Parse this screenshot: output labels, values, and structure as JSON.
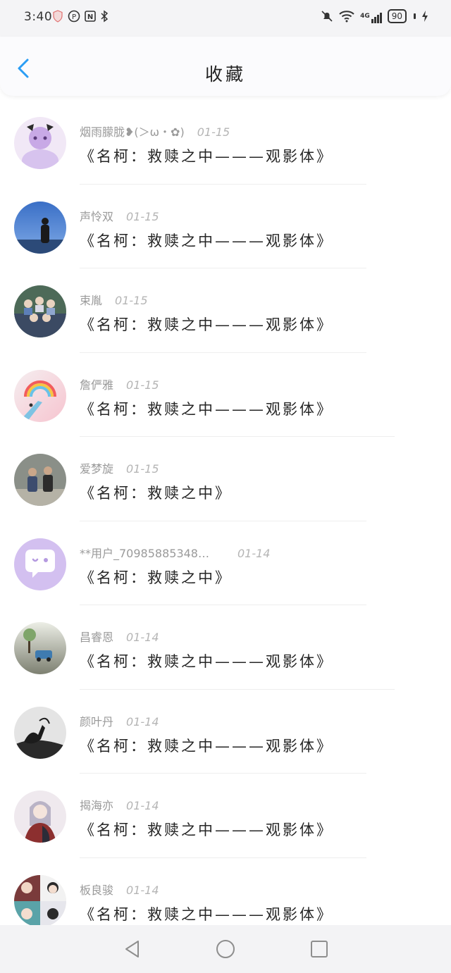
{
  "status_bar": {
    "time": "3:40",
    "left_icons": [
      "shield-icon",
      "nfc-p-icon",
      "nfc-n-icon",
      "bluetooth-icon"
    ],
    "right_icons": [
      "mute-bell-icon",
      "wifi-icon",
      "signal-4g-icon"
    ],
    "network": "4G",
    "battery": "90"
  },
  "header": {
    "title": "收藏",
    "back_icon": "chevron-left-icon"
  },
  "items": [
    {
      "user": "烟雨朦胧❥(＞ω・✿)",
      "date": "01-15",
      "text": "《名柯：救赎之中———观影体》"
    },
    {
      "user": "声怜双",
      "date": "01-15",
      "text": "《名柯：救赎之中———观影体》"
    },
    {
      "user": "束胤",
      "date": "01-15",
      "text": "《名柯：救赎之中———观影体》"
    },
    {
      "user": "詹俨雅",
      "date": "01-15",
      "text": "《名柯：救赎之中———观影体》"
    },
    {
      "user": "爱梦旋",
      "date": "01-15",
      "text": "《名柯：救赎之中》"
    },
    {
      "user": "**用户_709858853​48…",
      "date": "01-14",
      "text": "《名柯：救赎之中》"
    },
    {
      "user": "昌睿恩",
      "date": "01-14",
      "text": "《名柯：救赎之中———观影体》"
    },
    {
      "user": "颜叶丹",
      "date": "01-14",
      "text": "《名柯：救赎之中———观影体》"
    },
    {
      "user": "揭海亦",
      "date": "01-14",
      "text": "《名柯：救赎之中———观影体》"
    },
    {
      "user": "板良骏",
      "date": "01-14",
      "text": "《名柯：救赎之中———观影体》"
    }
  ],
  "nav_bar": {
    "back": "triangle-back-icon",
    "home": "circle-home-icon",
    "recents": "square-recents-icon"
  },
  "colors": {
    "accent": "#2a9df4",
    "header_bg": "#fbfbfd",
    "meta_text": "#9a9a9a"
  }
}
